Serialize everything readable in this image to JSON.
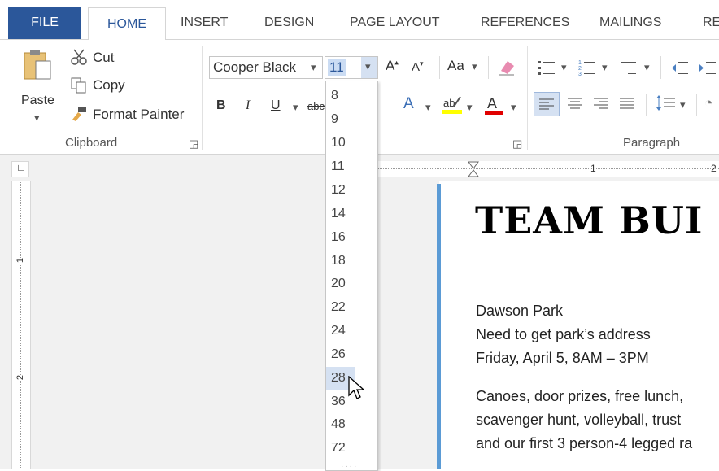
{
  "tabs": [
    "FILE",
    "HOME",
    "INSERT",
    "DESIGN",
    "PAGE LAYOUT",
    "REFERENCES",
    "MAILINGS",
    "RE"
  ],
  "clipboard": {
    "paste": "Paste",
    "cut": "Cut",
    "copy": "Copy",
    "format_painter": "Format Painter",
    "group_label": "Clipboard"
  },
  "font": {
    "name": "Cooper Black",
    "size": "11",
    "bold": "B",
    "italic": "I",
    "underline": "U",
    "change_case": "Aa",
    "strike": "abc"
  },
  "paragraph": {
    "group_label": "Paragraph"
  },
  "font_sizes": [
    "8",
    "9",
    "10",
    "11",
    "12",
    "14",
    "16",
    "18",
    "20",
    "22",
    "24",
    "26",
    "28",
    "36",
    "48",
    "72"
  ],
  "highlighted_size": "28",
  "ruler": {
    "h_mark": "1",
    "h_mark2": "2",
    "v_mark1": "1",
    "v_mark2": "2"
  },
  "document": {
    "title": "TEAM BUI",
    "lines1": [
      "Dawson Park",
      "Need to get park’s address",
      "Friday, April 5, 8AM – 3PM"
    ],
    "lines2": [
      "Canoes, door prizes, free lunch,",
      "scavenger hunt, volleyball, trust",
      "and our first 3 person-4 legged ra"
    ]
  },
  "colors": {
    "accent": "#2b579a",
    "highlight": "#d5e1f2",
    "font_color": "#e00000",
    "highlighter": "#ffff00"
  }
}
